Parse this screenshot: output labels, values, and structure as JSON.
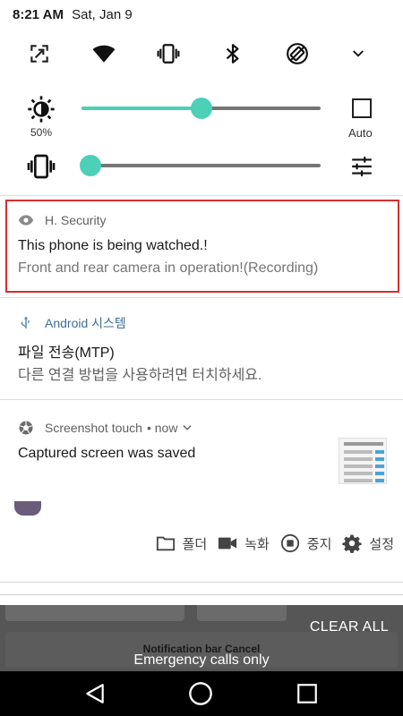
{
  "status_bar": {
    "time": "8:21 AM",
    "date": "Sat, Jan 9"
  },
  "quick_settings": {
    "tiles": [
      "screen-capture-icon",
      "wifi-icon",
      "vibrate-icon",
      "bluetooth-icon",
      "auto-rotate-icon",
      "expand-icon"
    ],
    "brightness": {
      "label": "50%",
      "level_percent": 50,
      "auto_label": "Auto",
      "auto_checked": false
    },
    "volume": {
      "level_percent": 0
    }
  },
  "notifications": [
    {
      "app": "H. Security",
      "icon": "eye-icon",
      "title": "This phone is being watched.!",
      "body": "Front and rear camera in operation!(Recording)"
    },
    {
      "app": "Android 시스템",
      "icon": "usb-icon",
      "title": "파일 전송(MTP)",
      "body": "다른 연결 방법을 사용하려면 터치하세요."
    },
    {
      "app": "Screenshot touch",
      "app_suffix": "• now",
      "icon": "aperture-icon",
      "title": "Captured screen was saved",
      "actions": [
        {
          "label": "폴더",
          "icon": "folder-icon"
        },
        {
          "label": "녹화",
          "icon": "video-icon"
        },
        {
          "label": "중지",
          "icon": "stop-icon"
        },
        {
          "label": "설정",
          "icon": "gear-icon"
        }
      ]
    }
  ],
  "background": {
    "behind_button_label": "Notification bar Cancel"
  },
  "clear_all": "CLEAR ALL",
  "emergency_text": "Emergency calls only",
  "nav": [
    "back-icon",
    "home-icon",
    "recents-icon"
  ],
  "colors": {
    "accent": "#4dd0b8",
    "highlight": "#d32f2f"
  }
}
